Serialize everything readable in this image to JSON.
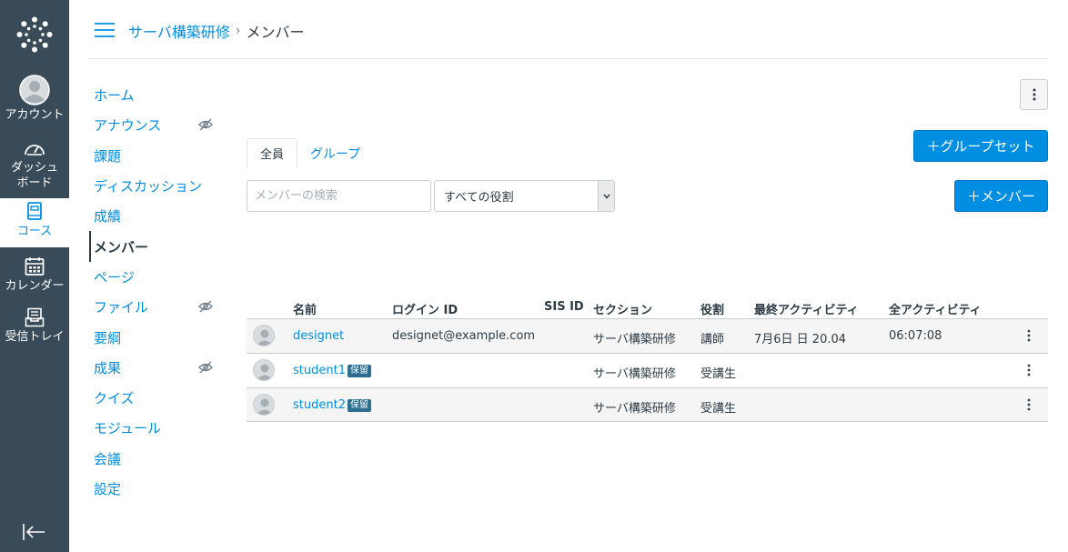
{
  "global_nav": {
    "account": "アカウント",
    "dashboard_l1": "ダッシュ",
    "dashboard_l2": "ボード",
    "courses": "コース",
    "calendar": "カレンダー",
    "inbox": "受信トレイ"
  },
  "header": {
    "course": "サーバ構築研修",
    "separator": "›",
    "page": "メンバー"
  },
  "course_nav": [
    {
      "label": "ホーム"
    },
    {
      "label": "アナウンス"
    },
    {
      "label": "課題"
    },
    {
      "label": "ディスカッション"
    },
    {
      "label": "成績"
    },
    {
      "label": "メンバー"
    },
    {
      "label": "ページ"
    },
    {
      "label": "ファイル"
    },
    {
      "label": "要綱"
    },
    {
      "label": "成果"
    },
    {
      "label": "クイズ"
    },
    {
      "label": "モジュール"
    },
    {
      "label": "会議"
    },
    {
      "label": "設定"
    }
  ],
  "buttons": {
    "group_set": "＋グループセット",
    "add_member": "＋メンバー"
  },
  "tabs": {
    "all": "全員",
    "groups": "グループ"
  },
  "filters": {
    "search_placeholder": "メンバーの検索",
    "role_selected": "すべての役割"
  },
  "table": {
    "headers": {
      "name": "名前",
      "login": "ログイン ID",
      "sis": "SIS ID",
      "section": "セクション",
      "role": "役割",
      "last_activity": "最終アクティビティ",
      "total_activity": "全アクティビティ"
    },
    "rows": [
      {
        "name": "designet",
        "badge": "",
        "login": "designet@example.com",
        "sis": "",
        "section": "サーバ構築研修",
        "role": "講師",
        "last_activity": "7月6日 日 20.04",
        "total_activity": "06:07:08"
      },
      {
        "name": "student1",
        "badge": "保留",
        "login": "",
        "sis": "",
        "section": "サーバ構築研修",
        "role": "受講生",
        "last_activity": "",
        "total_activity": ""
      },
      {
        "name": "student2",
        "badge": "保留",
        "login": "",
        "sis": "",
        "section": "サーバ構築研修",
        "role": "受講生",
        "last_activity": "",
        "total_activity": ""
      }
    ]
  },
  "colors": {
    "nav_bg": "#394b58",
    "link": "#008ee2",
    "primary_button": "#008ee2",
    "badge": "#2d6d8f"
  }
}
